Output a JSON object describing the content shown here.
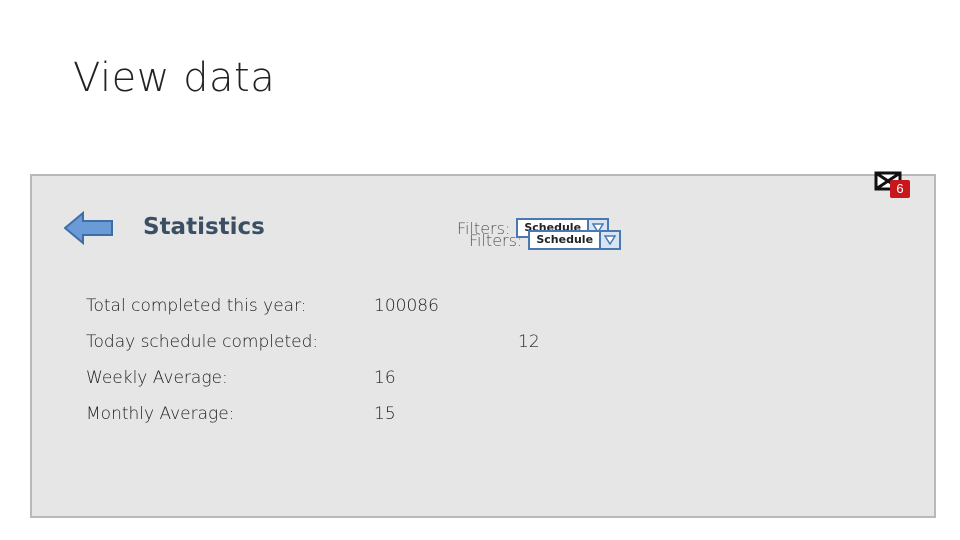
{
  "page": {
    "title": "View data"
  },
  "notification": {
    "count": "6",
    "icon": "close-icon",
    "badge_color": "#c8161d"
  },
  "panel": {
    "back_icon": "left-arrow-icon",
    "heading": "Statistics",
    "filters": [
      {
        "label": "Filters:",
        "value": "Schedule",
        "icon": "dropdown-triangle-icon"
      },
      {
        "label": "Filters:",
        "value": "Schedule",
        "icon": "dropdown-triangle-icon"
      }
    ],
    "stats": [
      {
        "label": "Total completed this year:",
        "value": "100086"
      },
      {
        "label": "Today schedule completed:",
        "value": "12"
      },
      {
        "label": "Weekly Average:",
        "value": "16"
      },
      {
        "label": "Monthly Average:",
        "value": "15"
      }
    ]
  },
  "colors": {
    "panel_bg": "#e6e6e6",
    "accent": "#4a78b0",
    "arrow_fill": "#6a9bd6",
    "heading": "#3a4f63"
  }
}
